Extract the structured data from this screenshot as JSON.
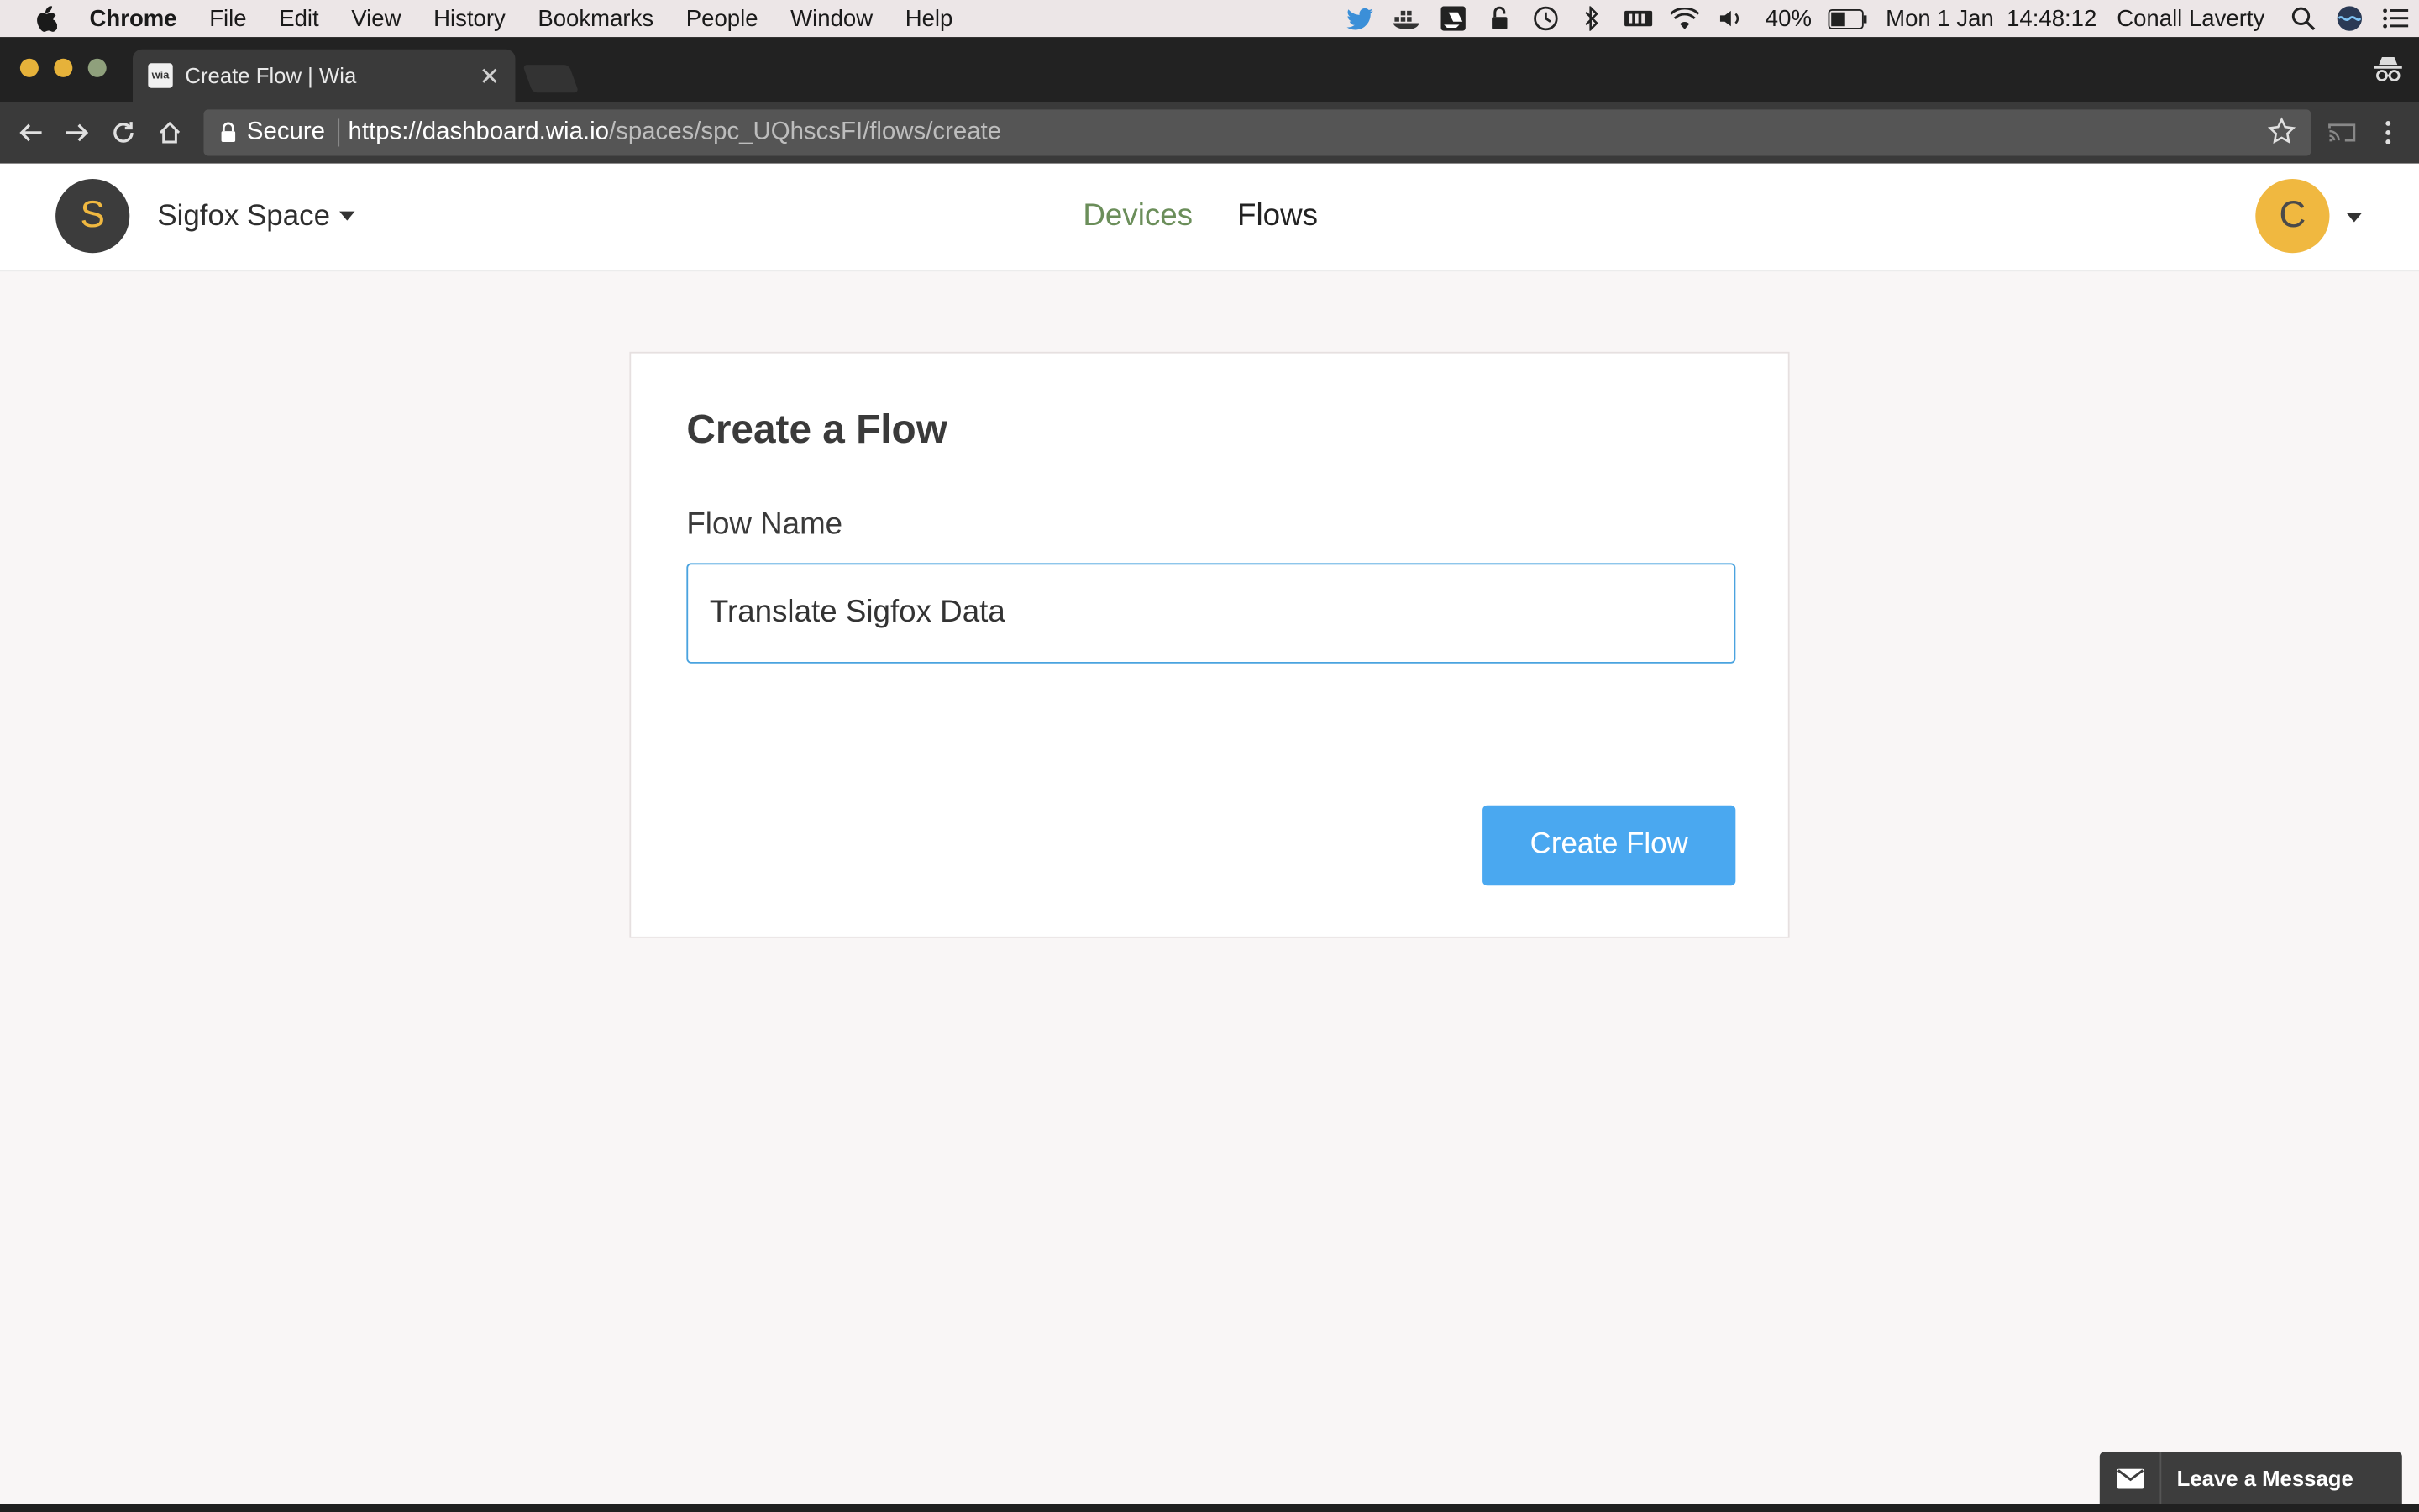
{
  "menubar": {
    "app_name": "Chrome",
    "items": [
      "File",
      "Edit",
      "View",
      "History",
      "Bookmarks",
      "People",
      "Window",
      "Help"
    ],
    "battery": "40%",
    "datetime": "Mon 1 Jan  14:48:12",
    "user": "Conall Laverty"
  },
  "browser": {
    "tab_title": "Create Flow | Wia",
    "favicon_text": "wia",
    "secure_label": "Secure",
    "url_host": "https://dashboard.wia.io",
    "url_path": "/spaces/spc_UQhscsFI/flows/create"
  },
  "header": {
    "space_initial": "S",
    "space_name": "Sigfox Space",
    "nav": {
      "devices": "Devices",
      "flows": "Flows"
    },
    "user_initial": "C"
  },
  "form": {
    "title": "Create a Flow",
    "field_label": "Flow Name",
    "field_value": "Translate Sigfox Data",
    "submit_label": "Create Flow"
  },
  "chat": {
    "label": "Leave a Message"
  },
  "colors": {
    "accent_blue": "#4aa8f0",
    "nav_active_green": "#6b8e5a",
    "avatar_yellow": "#f0b840"
  }
}
